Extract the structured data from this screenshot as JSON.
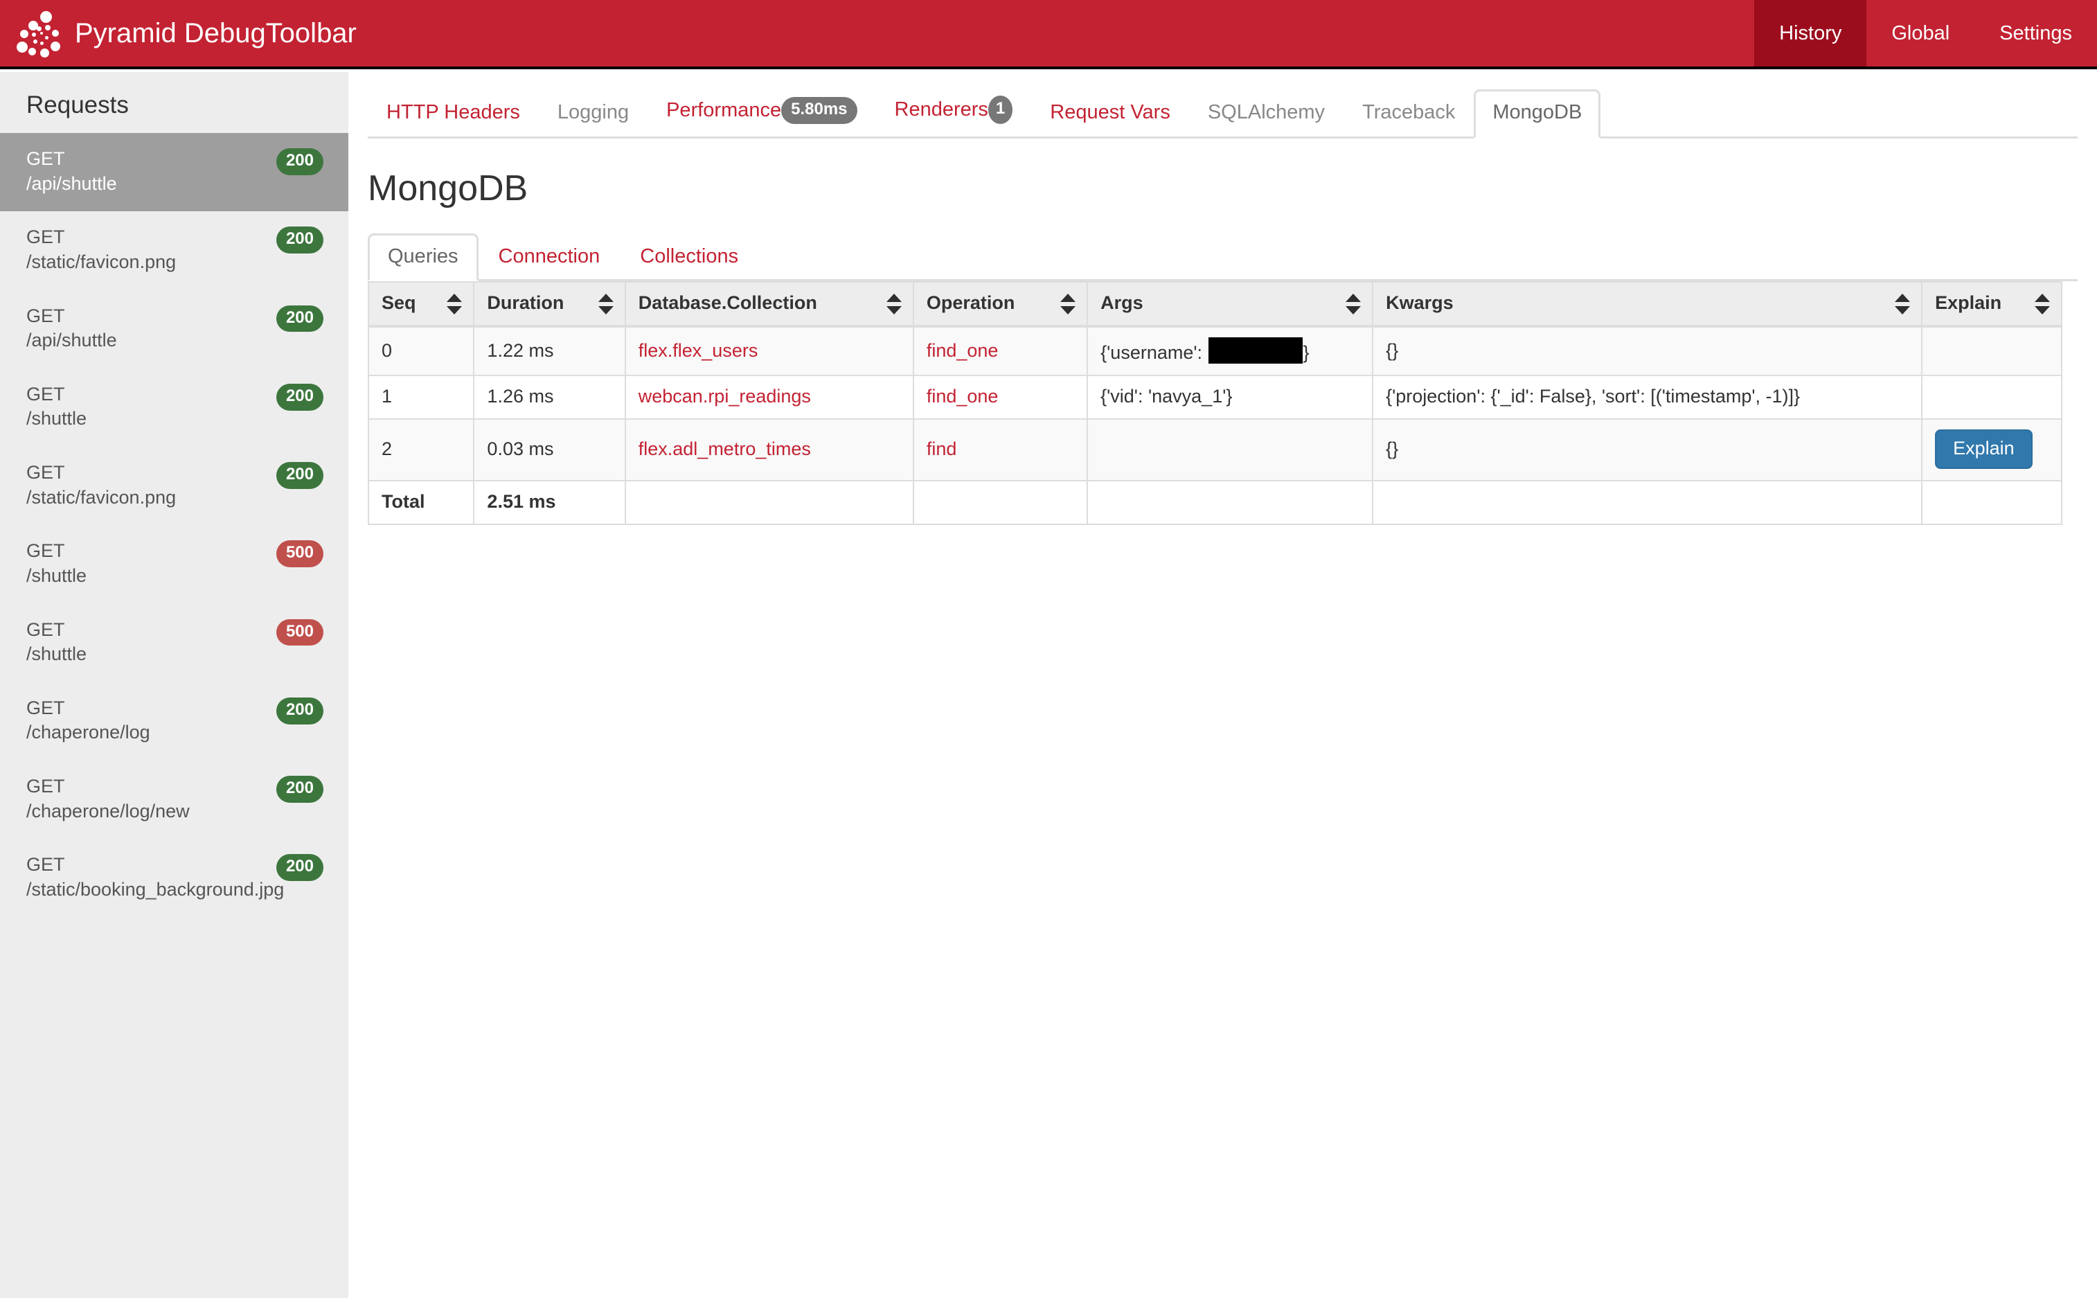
{
  "header": {
    "brand": "Pyramid DebugToolbar",
    "logo_icon": "pyramid-dots-logo-icon",
    "nav": [
      {
        "label": "History",
        "active": true
      },
      {
        "label": "Global",
        "active": false
      },
      {
        "label": "Settings",
        "active": false
      }
    ],
    "colors": {
      "bar": "#c32232",
      "active_nav": "#9b0d1d"
    }
  },
  "sidebar": {
    "title": "Requests",
    "items": [
      {
        "method": "GET",
        "path": "/api/shuttle",
        "status": "200",
        "state": "ok",
        "active": true
      },
      {
        "method": "GET",
        "path": "/static/favicon.png",
        "status": "200",
        "state": "ok",
        "active": false
      },
      {
        "method": "GET",
        "path": "/api/shuttle",
        "status": "200",
        "state": "ok",
        "active": false
      },
      {
        "method": "GET",
        "path": "/shuttle",
        "status": "200",
        "state": "ok",
        "active": false
      },
      {
        "method": "GET",
        "path": "/static/favicon.png",
        "status": "200",
        "state": "ok",
        "active": false
      },
      {
        "method": "GET",
        "path": "/shuttle",
        "status": "500",
        "state": "err",
        "active": false
      },
      {
        "method": "GET",
        "path": "/shuttle",
        "status": "500",
        "state": "err",
        "active": false
      },
      {
        "method": "GET",
        "path": "/chaperone/log",
        "status": "200",
        "state": "ok",
        "active": false
      },
      {
        "method": "GET",
        "path": "/chaperone/log/new",
        "status": "200",
        "state": "ok",
        "active": false
      },
      {
        "method": "GET",
        "path": "/static/booking_background.jpg",
        "status": "200",
        "state": "ok",
        "active": false
      }
    ],
    "badge_colors": {
      "ok": "#3c763d",
      "err": "#c0504c"
    }
  },
  "toolbar_tabs": [
    {
      "label": "HTTP Headers",
      "badge": null,
      "style": "link",
      "active": false
    },
    {
      "label": "Logging",
      "badge": null,
      "style": "muted",
      "active": false
    },
    {
      "label": "Performance",
      "badge": "5.80ms",
      "style": "link",
      "active": false,
      "badge_shape": "pill"
    },
    {
      "label": "Renderers",
      "badge": "1",
      "style": "link",
      "active": false,
      "badge_shape": "round"
    },
    {
      "label": "Request Vars",
      "badge": null,
      "style": "link",
      "active": false
    },
    {
      "label": "SQLAlchemy",
      "badge": null,
      "style": "muted",
      "active": false
    },
    {
      "label": "Traceback",
      "badge": null,
      "style": "muted",
      "active": false
    },
    {
      "label": "MongoDB",
      "badge": null,
      "style": "active",
      "active": true
    }
  ],
  "page": {
    "title": "MongoDB",
    "subtabs": [
      {
        "label": "Queries",
        "active": true
      },
      {
        "label": "Connection",
        "active": false
      },
      {
        "label": "Collections",
        "active": false
      }
    ]
  },
  "table": {
    "columns": [
      {
        "label": "Seq",
        "sortable": true
      },
      {
        "label": "Duration",
        "sortable": true
      },
      {
        "label": "Database.Collection",
        "sortable": true
      },
      {
        "label": "Operation",
        "sortable": true
      },
      {
        "label": "Args",
        "sortable": true
      },
      {
        "label": "Kwargs",
        "sortable": true
      },
      {
        "label": "Explain",
        "sortable": true
      }
    ],
    "rows": [
      {
        "seq": "0",
        "duration": "1.22 ms",
        "collection": "flex.flex_users",
        "operation": "find_one",
        "args_prefix": "{'username': ",
        "args_redacted": true,
        "args_suffix": "}",
        "kwargs": "{}",
        "explain": null
      },
      {
        "seq": "1",
        "duration": "1.26 ms",
        "collection": "webcan.rpi_readings",
        "operation": "find_one",
        "args_prefix": "{'vid': 'navya_1'}",
        "args_redacted": false,
        "args_suffix": "",
        "kwargs": "{'projection': {'_id': False}, 'sort': [('timestamp', -1)]}",
        "explain": null
      },
      {
        "seq": "2",
        "duration": "0.03 ms",
        "collection": "flex.adl_metro_times",
        "operation": "find",
        "args_prefix": "",
        "args_redacted": false,
        "args_suffix": "",
        "kwargs": "{}",
        "explain": "Explain"
      }
    ],
    "total": {
      "label": "Total",
      "duration": "2.51 ms"
    },
    "explain_button_color": "#3178ac"
  }
}
